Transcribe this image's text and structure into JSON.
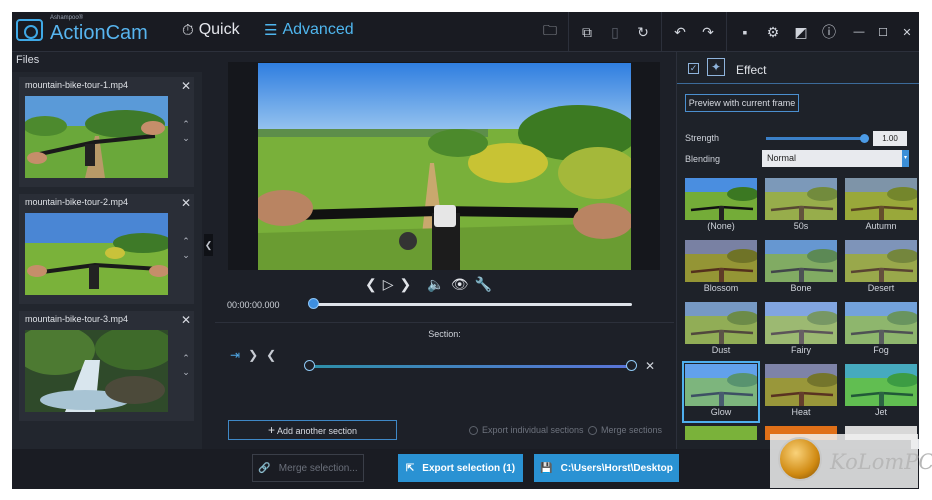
{
  "header": {
    "brand_small": "Ashampoo®",
    "brand": "ActionCam",
    "mode_quick": "Quick",
    "mode_advanced": "Advanced",
    "icons": [
      "folder-icon",
      "copy-icon",
      "paste-icon",
      "rotate-icon",
      "undo-icon",
      "redo-icon",
      "feedback-icon",
      "settings-icon",
      "theme-icon",
      "info-icon"
    ],
    "window": {
      "minimize": "—",
      "maximize": "☐",
      "close": "✕"
    }
  },
  "files": {
    "title": "Files",
    "items": [
      {
        "name": "mountain-bike-tour-1.mp4"
      },
      {
        "name": "mountain-bike-tour-2.mp4"
      },
      {
        "name": "mountain-bike-tour-3.mp4"
      }
    ]
  },
  "player": {
    "timecode": "00:00:00.000",
    "progress": 0
  },
  "section": {
    "label": "Section:",
    "add_label": "Add another section",
    "export_individual": "Export individual sections",
    "merge_sections": "Merge sections"
  },
  "effects": {
    "title": "Effect",
    "enabled": true,
    "preview_button": "Preview with current frame",
    "strength_label": "Strength",
    "strength_value": "1.00",
    "blending_label": "Blending",
    "blending_value": "Normal",
    "presets": [
      "(None)",
      "50s",
      "Autumn",
      "Blossom",
      "Bone",
      "Desert",
      "Dust",
      "Fairy",
      "Fog",
      "Glow",
      "Heat",
      "Jet"
    ],
    "selected": "Glow"
  },
  "bottom": {
    "merge": "Merge selection...",
    "export": "Export selection (1)",
    "path": "C:\\Users\\Horst\\Desktop"
  },
  "watermark": {
    "text": "KoLomPC"
  },
  "colors": {
    "accent": "#2a92d3",
    "bg": "#1d2028",
    "brand": "#57b4ee"
  }
}
